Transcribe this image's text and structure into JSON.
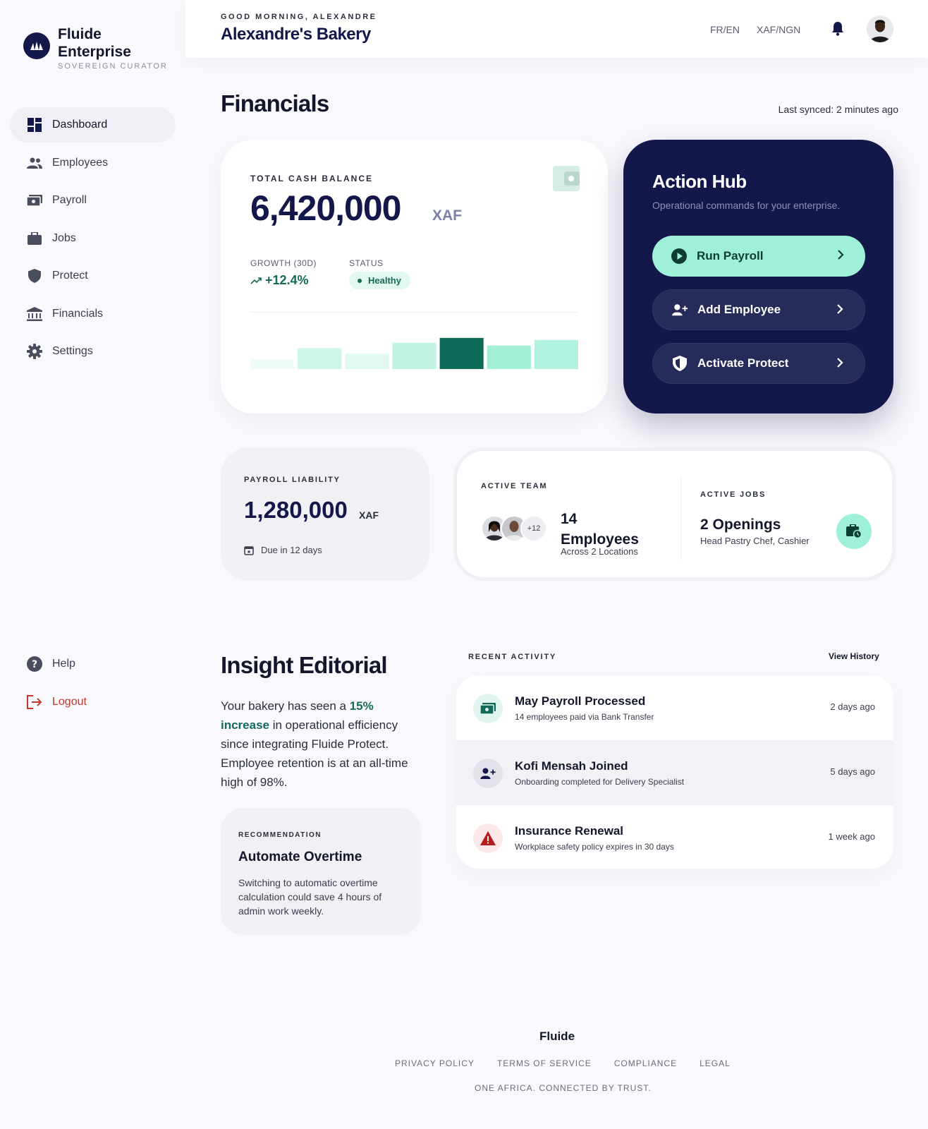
{
  "brand": {
    "name": "Fluide Enterprise",
    "sub": "SOVEREIGN CURATOR"
  },
  "nav": [
    {
      "label": "Dashboard",
      "icon": "dashboard-icon",
      "active": true
    },
    {
      "label": "Employees",
      "icon": "people-icon"
    },
    {
      "label": "Payroll",
      "icon": "payments-icon"
    },
    {
      "label": "Jobs",
      "icon": "briefcase-icon"
    },
    {
      "label": "Protect",
      "icon": "shield-icon"
    },
    {
      "label": "Financials",
      "icon": "bank-icon"
    },
    {
      "label": "Settings",
      "icon": "gear-icon"
    }
  ],
  "nav_bottom": {
    "help": "Help",
    "logout": "Logout"
  },
  "header": {
    "greeting": "GOOD MORNING, ALEXANDRE",
    "business": "Alexandre's Bakery",
    "lang": "FR/EN",
    "currency": "XAF/NGN"
  },
  "page": {
    "title": "Financials",
    "synced": "Last synced: 2 minutes ago"
  },
  "cash": {
    "label": "TOTAL CASH BALANCE",
    "amount": "6,420,000",
    "currency": "XAF",
    "growth_label": "GROWTH (30D)",
    "growth_value": "+12.4%",
    "status_label": "STATUS",
    "status_value": "Healthy"
  },
  "chart_data": {
    "type": "bar",
    "categories": [
      "1",
      "2",
      "3",
      "4",
      "5",
      "6",
      "7"
    ],
    "values": [
      14,
      30,
      22,
      38,
      45,
      34,
      42
    ],
    "ylim": [
      0,
      50
    ],
    "highlight_index": 4,
    "colors": [
      "#eefbf6",
      "#cdf5e8",
      "#e0f8f0",
      "#bff2e3",
      "#0e6b58",
      "#a2efd8",
      "#b2f1df"
    ]
  },
  "hub": {
    "title": "Action Hub",
    "subtitle": "Operational commands for your enterprise.",
    "run_payroll": "Run Payroll",
    "add_employee": "Add Employee",
    "activate_protect": "Activate Protect"
  },
  "liability": {
    "label": "PAYROLL LIABILITY",
    "amount": "1,280,000",
    "currency": "XAF",
    "due": "Due in 12 days"
  },
  "team": {
    "label": "ACTIVE TEAM",
    "extra": "+12",
    "count_line1": "14",
    "count_line2": "Employees",
    "sub": "Across 2 Locations"
  },
  "jobs": {
    "label": "ACTIVE JOBS",
    "count": "2 Openings",
    "sub": "Head Pastry Chef, Cashier"
  },
  "insight": {
    "title": "Insight Editorial",
    "text_before": "Your bakery has seen a ",
    "highlight": "15% increase",
    "text_after": " in operational efficiency since integrating Fluide Protect. Employee retention is at an all-time high of 98%."
  },
  "recommendation": {
    "label": "RECOMMENDATION",
    "title": "Automate Overtime",
    "text": "Switching to automatic overtime calculation could save 4 hours of admin work weekly."
  },
  "activity": {
    "label": "RECENT ACTIVITY",
    "history": "View History",
    "items": [
      {
        "title": "May Payroll Processed",
        "sub": "14 employees paid via Bank Transfer",
        "time": "2 days ago",
        "icon": "payments-icon"
      },
      {
        "title": "Kofi Mensah Joined",
        "sub": "Onboarding completed for Delivery Specialist",
        "time": "5 days ago",
        "icon": "person-add-icon"
      },
      {
        "title": "Insurance Renewal",
        "sub": "Workplace safety policy expires in 30 days",
        "time": "1 week ago",
        "icon": "warning-icon"
      }
    ]
  },
  "footer": {
    "brand": "Fluide",
    "links": [
      "PRIVACY POLICY",
      "TERMS OF SERVICE",
      "COMPLIANCE",
      "LEGAL"
    ],
    "tagline": "ONE AFRICA. CONNECTED BY TRUST."
  }
}
